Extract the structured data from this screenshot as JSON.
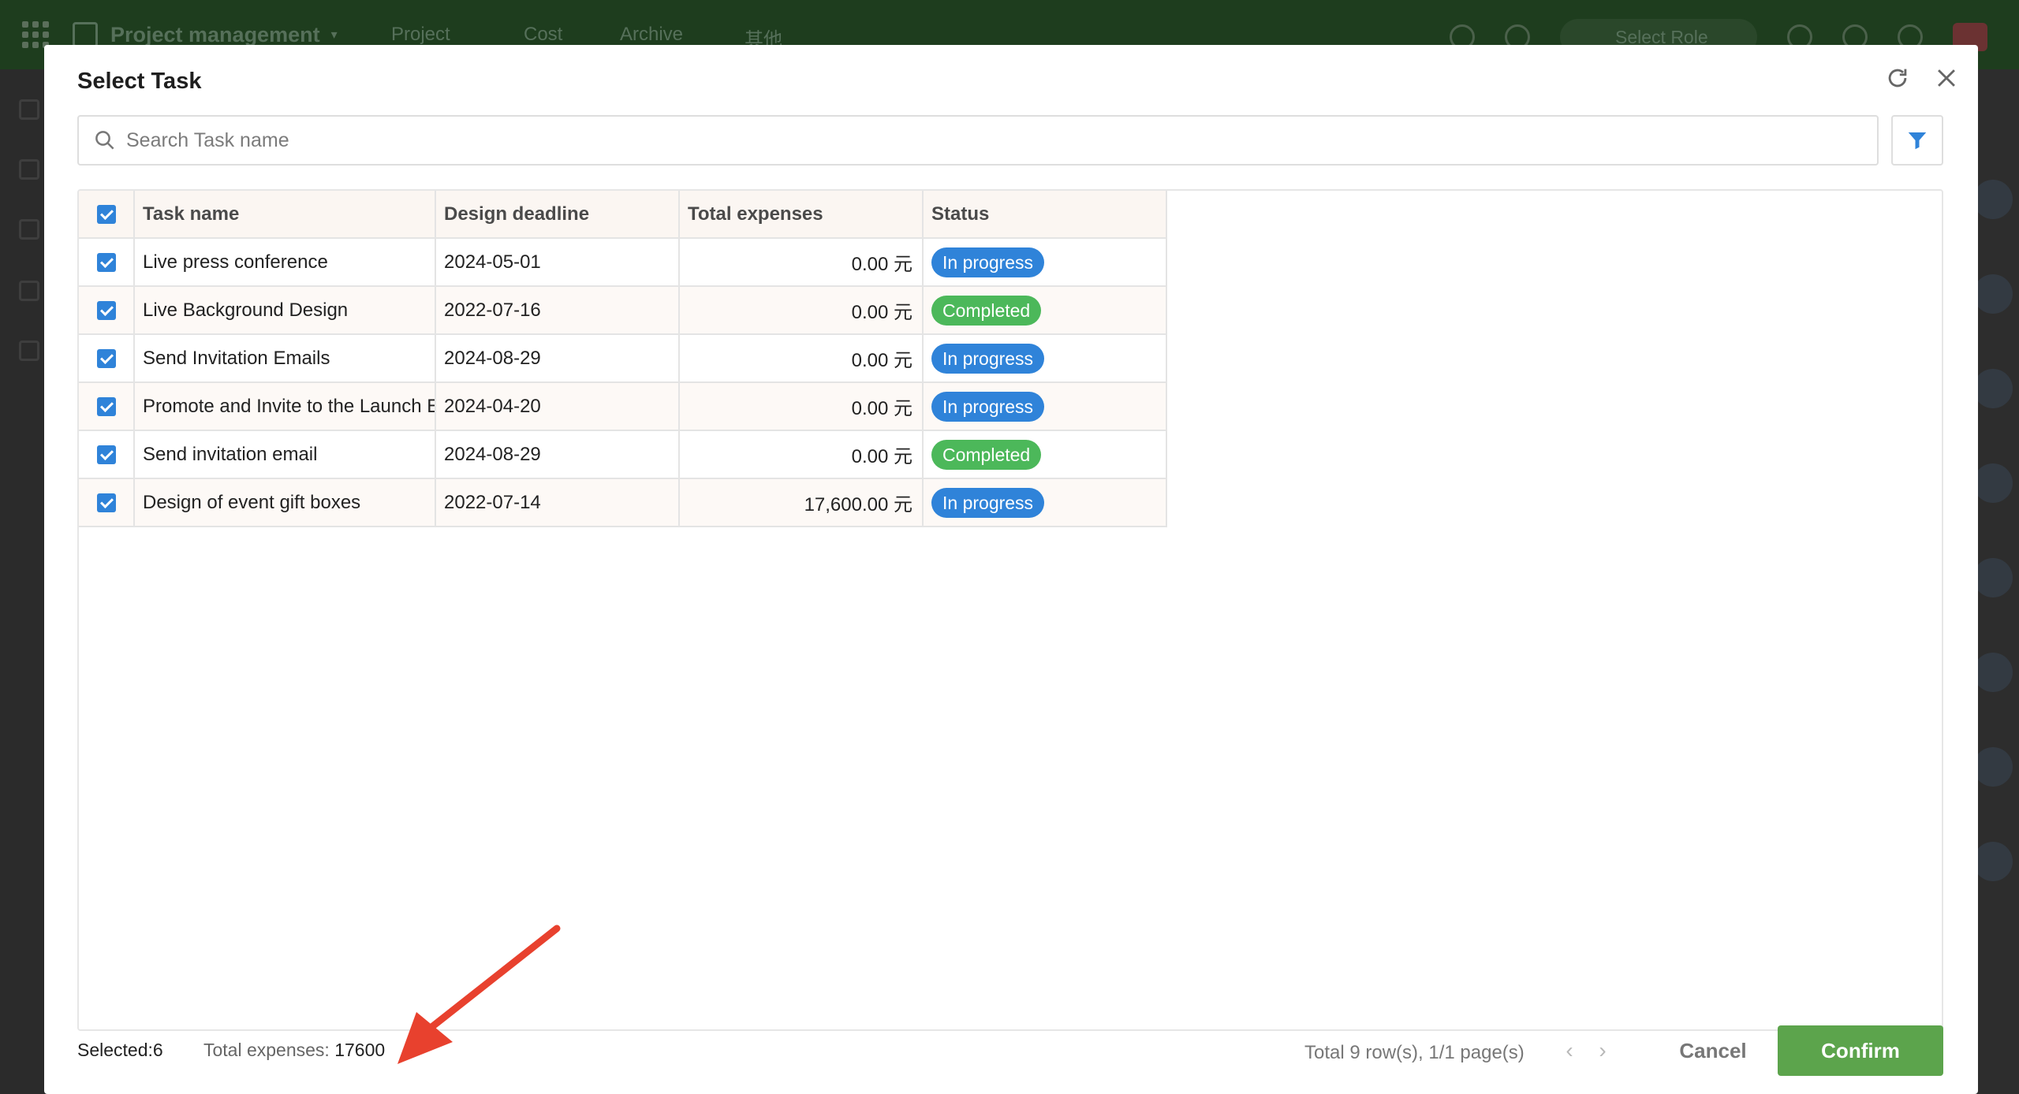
{
  "background_app": {
    "title": "Project management",
    "nav": [
      "Project",
      "Cost",
      "Archive",
      "其他"
    ],
    "role_label": "Select Role"
  },
  "modal": {
    "title": "Select Task",
    "search": {
      "placeholder": "Search Task name",
      "value": ""
    },
    "table": {
      "columns": [
        "Task name",
        "Design deadline",
        "Total expenses",
        "Status"
      ],
      "rows": [
        {
          "checked": true,
          "task": "Live press conference",
          "deadline": "2024-05-01",
          "expenses": "0.00 元",
          "status": "In progress"
        },
        {
          "checked": true,
          "task": "Live Background Design",
          "deadline": "2022-07-16",
          "expenses": "0.00 元",
          "status": "Completed"
        },
        {
          "checked": true,
          "task": "Send Invitation Emails",
          "deadline": "2024-08-29",
          "expenses": "0.00 元",
          "status": "In progress"
        },
        {
          "checked": true,
          "task": "Promote and Invite to the Launch Event",
          "deadline": "2024-04-20",
          "expenses": "0.00 元",
          "status": "In progress"
        },
        {
          "checked": true,
          "task": "Send invitation email",
          "deadline": "2024-08-29",
          "expenses": "0.00 元",
          "status": "Completed"
        },
        {
          "checked": true,
          "task": "Design of event gift boxes",
          "deadline": "2022-07-14",
          "expenses": "17,600.00 元",
          "status": "In progress"
        }
      ]
    },
    "status_colors": {
      "In progress": "#2f83d9",
      "Completed": "#4cb85a"
    },
    "footer": {
      "selected": "Selected:6",
      "total_label": "Total expenses: ",
      "total_value": "17600",
      "pager": "Total 9 row(s), 1/1 page(s)",
      "cancel": "Cancel",
      "confirm": "Confirm"
    },
    "colors": {
      "accent": "#2f83d9",
      "confirm": "#5ca44c",
      "annotation_arrow": "#e8412e"
    },
    "icons": [
      "refresh-icon",
      "close-icon",
      "search-icon",
      "filter-icon",
      "chevron-left-icon",
      "chevron-right-icon"
    ]
  }
}
